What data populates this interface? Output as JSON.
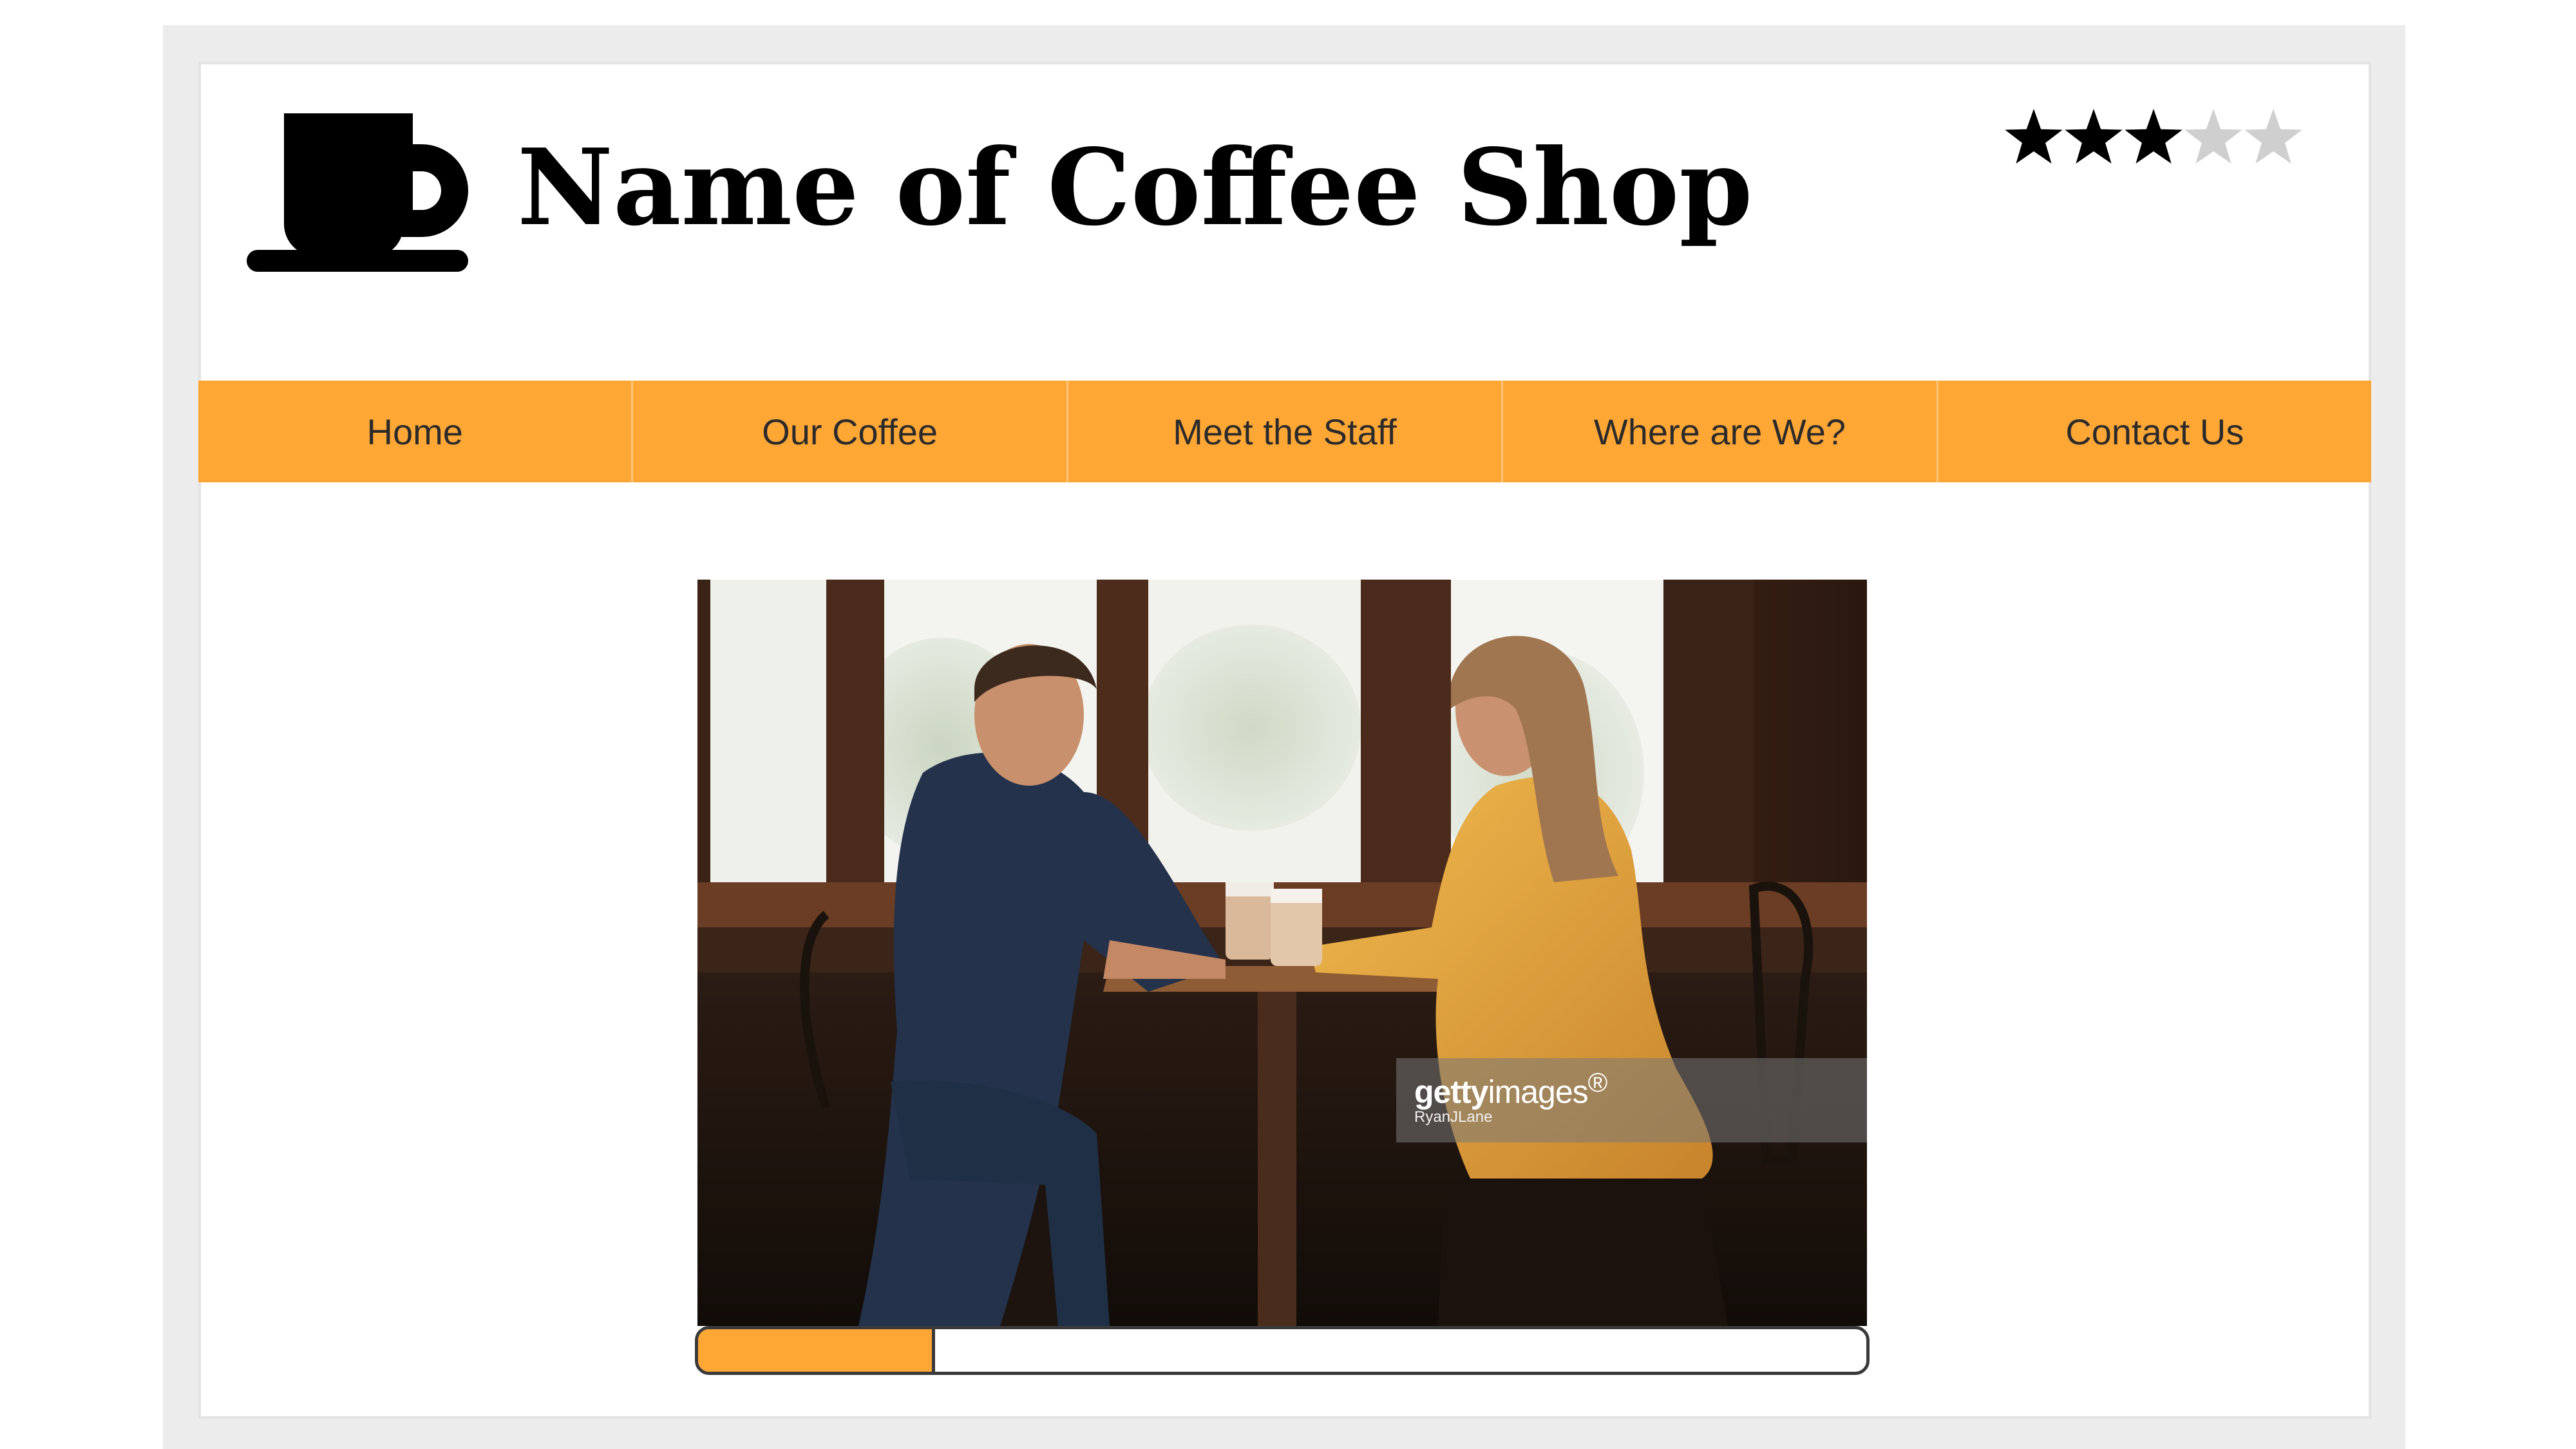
{
  "site": {
    "title": "Name of Coffee Shop",
    "logo_icon": "coffee-cup-icon",
    "accent_color": "#ffa735"
  },
  "rating": {
    "value": 3,
    "max": 5,
    "icon": "star-icon",
    "filled_color": "#000000",
    "empty_color": "#cfcfcf"
  },
  "nav": {
    "items": [
      {
        "label": "Home"
      },
      {
        "label": "Our Coffee"
      },
      {
        "label": "Meet the Staff"
      },
      {
        "label": "Where are We?"
      },
      {
        "label": "Contact Us"
      }
    ]
  },
  "hero": {
    "image_subject": "couple-drinking-coffee-photo",
    "watermark_brand_bold": "getty",
    "watermark_brand_light": "images",
    "watermark_brand_mark": "®",
    "watermark_credit": "RyanJLane"
  },
  "progress": {
    "fraction": 0.2
  }
}
